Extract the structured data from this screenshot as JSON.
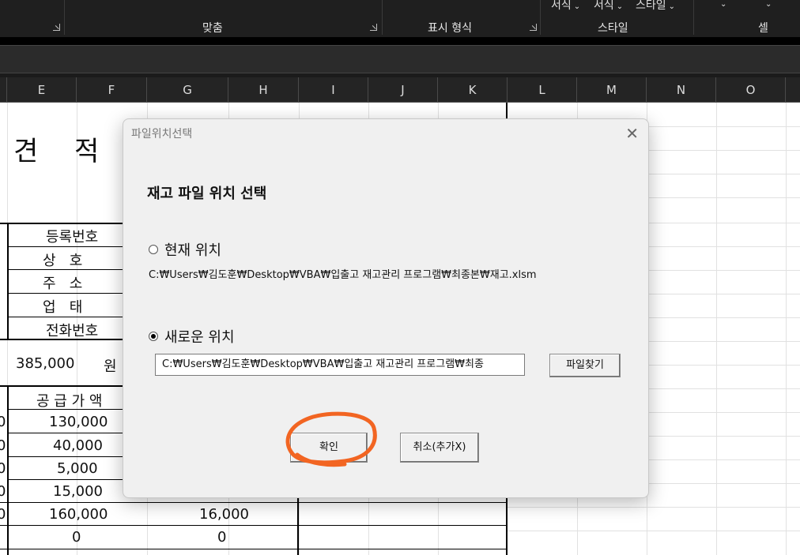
{
  "ribbon": {
    "groups": [
      {
        "label": "맞춤",
        "launcher_icon": "dialog-launcher-icon"
      },
      {
        "label": "표시 형식",
        "launcher_icon": "dialog-launcher-icon"
      },
      {
        "label": "스타일"
      },
      {
        "label": "셀"
      }
    ],
    "style_buttons": [
      "서식",
      "서식",
      "스타일"
    ]
  },
  "columns": [
    "E",
    "F",
    "G",
    "H",
    "I",
    "J",
    "K",
    "L",
    "M",
    "N",
    "O"
  ],
  "sheet": {
    "title_chars": [
      "견",
      "적"
    ],
    "info_labels": [
      "등록번호",
      "상   호",
      "주   소",
      "업   태",
      "전화번호"
    ],
    "total_amount": "385,000",
    "total_unit": "원",
    "supply_header": "공 급 가 액",
    "supply_values": [
      "130,000",
      "40,000",
      "5,000",
      "15,000",
      "160,000",
      "0"
    ],
    "tax_values": [
      "16,000",
      "0"
    ]
  },
  "dialog": {
    "title": "파일위치선택",
    "heading": "재고 파일 위치 선택",
    "option_current": "현재 위치",
    "current_path": "C:₩Users₩김도훈₩Desktop₩VBA₩입출고 재고관리 프로그램₩최종본₩재고.xlsm",
    "option_new": "새로운 위치",
    "new_path": "C:₩Users₩김도훈₩Desktop₩VBA₩입출고 재고관리 프로그램₩최종",
    "browse_label": "파일찾기",
    "ok_label": "확인",
    "cancel_label": "취소(추가X)",
    "selected_option": "새로운 위치",
    "annotation_color": "#f26522"
  }
}
